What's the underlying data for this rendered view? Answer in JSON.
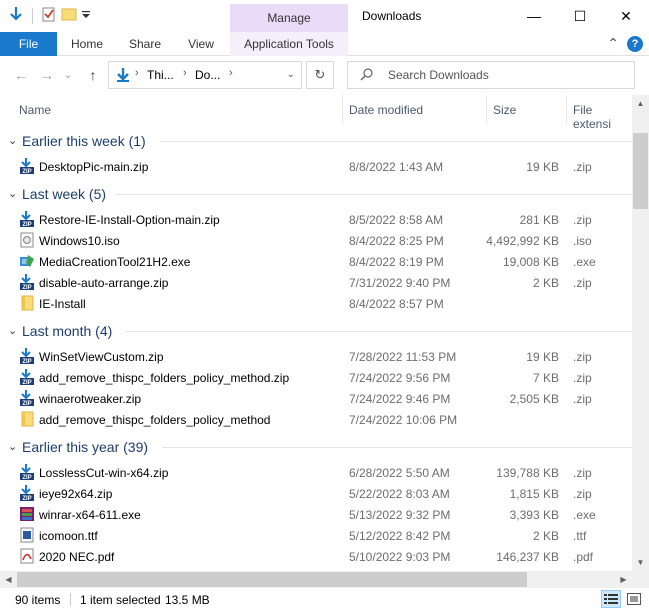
{
  "window": {
    "title": "Downloads",
    "contextual_tab_group": "Manage",
    "min_glyph": "—",
    "max_glyph": "☐",
    "close_glyph": "✕"
  },
  "ribbon": {
    "tabs": [
      "File",
      "Home",
      "Share",
      "View",
      "Application Tools"
    ],
    "collapse_glyph": "⌃",
    "help_glyph": "?"
  },
  "nav": {
    "back_glyph": "←",
    "forward_glyph": "→",
    "recent_glyph": "⌄",
    "up_glyph": "↑",
    "breadcrumbs": [
      "Thi...",
      "Do..."
    ],
    "crumb_sep": "›",
    "dropdown_glyph": "⌄",
    "refresh_glyph": "↻",
    "search_placeholder": "Search Downloads",
    "search_glyph": "⚲"
  },
  "columns": [
    "Name",
    "Date modified",
    "Size",
    "File extensi"
  ],
  "groups": [
    {
      "title": "Earlier this week (1)",
      "chevron": "⌄",
      "files": [
        {
          "name": "DesktopPic-main.zip",
          "date": "8/8/2022 1:43 AM",
          "size": "19 KB",
          "ext": ".zip",
          "icon": "zip-icon"
        }
      ]
    },
    {
      "title": "Last week (5)",
      "chevron": "⌄",
      "files": [
        {
          "name": "Restore-IE-Install-Option-main.zip",
          "date": "8/5/2022 8:58 AM",
          "size": "281 KB",
          "ext": ".zip",
          "icon": "zip-icon"
        },
        {
          "name": "Windows10.iso",
          "date": "8/4/2022 8:25 PM",
          "size": "4,492,992 KB",
          "ext": ".iso",
          "icon": "iso-icon"
        },
        {
          "name": "MediaCreationTool21H2.exe",
          "date": "8/4/2022 8:19 PM",
          "size": "19,008 KB",
          "ext": ".exe",
          "icon": "setup-icon"
        },
        {
          "name": "disable-auto-arrange.zip",
          "date": "7/31/2022 9:40 PM",
          "size": "2 KB",
          "ext": ".zip",
          "icon": "zip-icon"
        },
        {
          "name": "IE-Install",
          "date": "8/4/2022 8:57 PM",
          "size": "",
          "ext": "",
          "icon": "folder-icon"
        }
      ]
    },
    {
      "title": "Last month (4)",
      "chevron": "⌄",
      "files": [
        {
          "name": "WinSetViewCustom.zip",
          "date": "7/28/2022 11:53 PM",
          "size": "19 KB",
          "ext": ".zip",
          "icon": "zip-icon"
        },
        {
          "name": "add_remove_thispc_folders_policy_method.zip",
          "date": "7/24/2022 9:56 PM",
          "size": "7 KB",
          "ext": ".zip",
          "icon": "zip-icon"
        },
        {
          "name": "winaerotweaker.zip",
          "date": "7/24/2022 9:46 PM",
          "size": "2,505 KB",
          "ext": ".zip",
          "icon": "zip-icon"
        },
        {
          "name": "add_remove_thispc_folders_policy_method",
          "date": "7/24/2022 10:06 PM",
          "size": "",
          "ext": "",
          "icon": "folder-icon"
        }
      ]
    },
    {
      "title": "Earlier this year (39)",
      "chevron": "⌄",
      "files": [
        {
          "name": "LosslessCut-win-x64.zip",
          "date": "6/28/2022 5:50 AM",
          "size": "139,788 KB",
          "ext": ".zip",
          "icon": "zip-icon"
        },
        {
          "name": "ieye92x64.zip",
          "date": "5/22/2022 8:03 AM",
          "size": "1,815 KB",
          "ext": ".zip",
          "icon": "zip-icon"
        },
        {
          "name": "winrar-x64-611.exe",
          "date": "5/13/2022 9:32 PM",
          "size": "3,393 KB",
          "ext": ".exe",
          "icon": "winrar-icon"
        },
        {
          "name": "icomoon.ttf",
          "date": "5/12/2022 8:42 PM",
          "size": "2 KB",
          "ext": ".ttf",
          "icon": "font-file-icon"
        },
        {
          "name": "2020 NEC.pdf",
          "date": "5/10/2022 9:03 PM",
          "size": "146,237 KB",
          "ext": ".pdf",
          "icon": "pdf-icon"
        }
      ]
    }
  ],
  "status": {
    "items": "90 items",
    "selected": "1 item selected",
    "selected_size": "13.5 MB"
  },
  "colors": {
    "accent": "#1979ca",
    "group_header": "#1e3f6a",
    "contextual_tab": "#eadcf8"
  }
}
